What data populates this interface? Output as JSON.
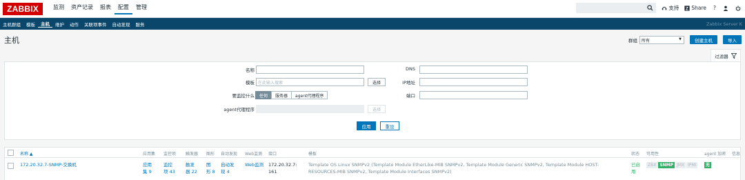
{
  "logo": "ZABBIX",
  "main_menu": [
    "监测",
    "资产记录",
    "报表",
    "配置",
    "管理"
  ],
  "top_right": {
    "support": "支持",
    "share": "Share",
    "help": "?"
  },
  "sub_menu": [
    "主机群组",
    "模板",
    "主机",
    "维护",
    "动作",
    "关联项事件",
    "自动发现",
    "服务"
  ],
  "server_name": "Zabbix Server K",
  "page_title": "主机",
  "group_label": "群组",
  "group_value": "所有",
  "create_host": "创建主机",
  "import": "导入",
  "filter_tab": "过滤器",
  "filter": {
    "name_label": "名称",
    "templates_label": "模板",
    "templates_placeholder": "在此输入搜索",
    "select": "选择",
    "monitored_by_label": "要监控什么",
    "monitored_by_options": [
      "任何",
      "服务器",
      "agent代理程序"
    ],
    "proxy_label": "agent代理程序",
    "dns_label": "DNS",
    "ip_label": "IP地址",
    "port_label": "端口",
    "apply": "应用",
    "reset": "重设"
  },
  "table": {
    "headers": {
      "name": "名称 ▲",
      "applications": "应用集",
      "items": "监控项",
      "triggers": "触发器",
      "graphs": "图形",
      "discovery": "自动发现",
      "web": "Web监测",
      "interface": "接口",
      "templates": "模板",
      "status": "状态",
      "availability": "可用性",
      "agent_encryption": "agent 加密",
      "info": "信息"
    },
    "row": {
      "name": "172.20.32.7-SNMP-交换机",
      "applications": [
        "应用",
        "集 9"
      ],
      "items": [
        "监控",
        "项 43"
      ],
      "triggers": [
        "触发",
        "器 22"
      ],
      "graphs": [
        "图",
        "形 8"
      ],
      "discovery": [
        "自动发",
        "现 4"
      ],
      "web": "Web监测",
      "interface": [
        "172.20.32.7:",
        "161"
      ],
      "templates": [
        "Template OS Linux SNMPv2 (Template Module EtherLike-MIB SNMPv2, Template Module Generic SNMPv2, Template Module HOST-",
        "RESOURCES-MIB SNMPv2, Template Module Interfaces SNMPv2)"
      ],
      "status": [
        "已启",
        "用"
      ],
      "availability": [
        "ZBX",
        "SNMP",
        "JMX",
        "IPMI"
      ],
      "encryption": "无"
    }
  },
  "colors": {
    "brand": "#d40000",
    "nav": "#0a466a",
    "accent": "#0275b8",
    "ok": "#34af67"
  }
}
